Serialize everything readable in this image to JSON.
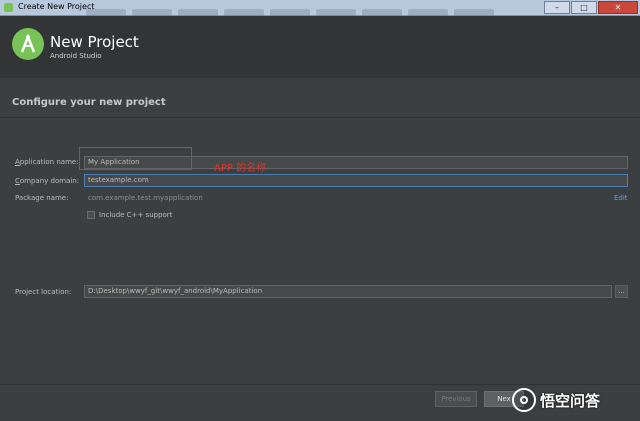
{
  "window": {
    "title": "Create New Project",
    "controls": {
      "minimize": "–",
      "maximize": "□",
      "close": "✕"
    }
  },
  "header": {
    "title": "New Project",
    "subtitle": "Android Studio"
  },
  "section": {
    "title": "Configure your new project"
  },
  "form": {
    "app_name": {
      "label_prefix": "A",
      "label_rest": "pplication name:",
      "value": "My Application"
    },
    "company_domain": {
      "label_prefix": "C",
      "label_rest": "ompany domain:",
      "value": "testexample.com"
    },
    "package_name": {
      "label": "Package name:",
      "value": "com.example.test.myapplication",
      "edit_label": "Edit"
    },
    "cpp_support": {
      "label": "Include C++ support",
      "checked": false
    },
    "project_location": {
      "label": "Project location:",
      "value": "D:\\Desktop\\wwyf_git\\wwyf_android\\MyApplication",
      "browse_label": "..."
    }
  },
  "annotation": {
    "text": "APP 的名称"
  },
  "footer": {
    "previous_label": "Previous",
    "next_label": "Nex"
  },
  "watermark": {
    "text": "悟空问答"
  },
  "colors": {
    "accent": "#4a7db3",
    "annotation": "#e0322a",
    "android_green": "#78c257"
  }
}
